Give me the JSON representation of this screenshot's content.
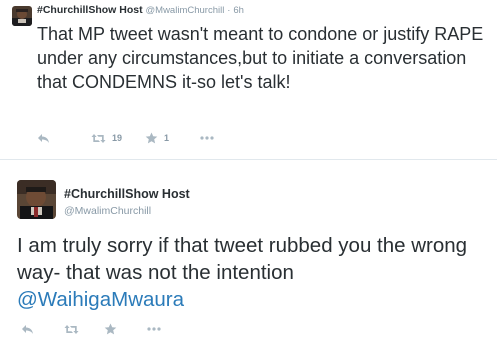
{
  "tweet1": {
    "display_name": "#ChurchillShow Host",
    "handle": "@MwalimChurchill",
    "separator": "·",
    "time": "6h",
    "text": "That MP tweet wasn't meant to condone or justify RAPE under any circumstances,but to initiate a conversation that CONDEMNS it-so let's talk!",
    "retweet_count": "19",
    "favorite_count": "1"
  },
  "tweet2": {
    "display_name": "#ChurchillShow Host",
    "handle": "@MwalimChurchill",
    "text": "I am truly sorry if that tweet rubbed you the wrong way- that was not the intention",
    "mention": "@WaihigaMwaura"
  },
  "icons": {
    "reply": "reply-icon",
    "retweet": "retweet-icon",
    "favorite": "star-icon",
    "more": "more-icon",
    "avatar": "avatar"
  },
  "colors": {
    "text": "#292f33",
    "muted": "#8899a6",
    "icon": "#aab8c2",
    "link": "#2b7bb9",
    "divider": "#e1e8ed"
  }
}
